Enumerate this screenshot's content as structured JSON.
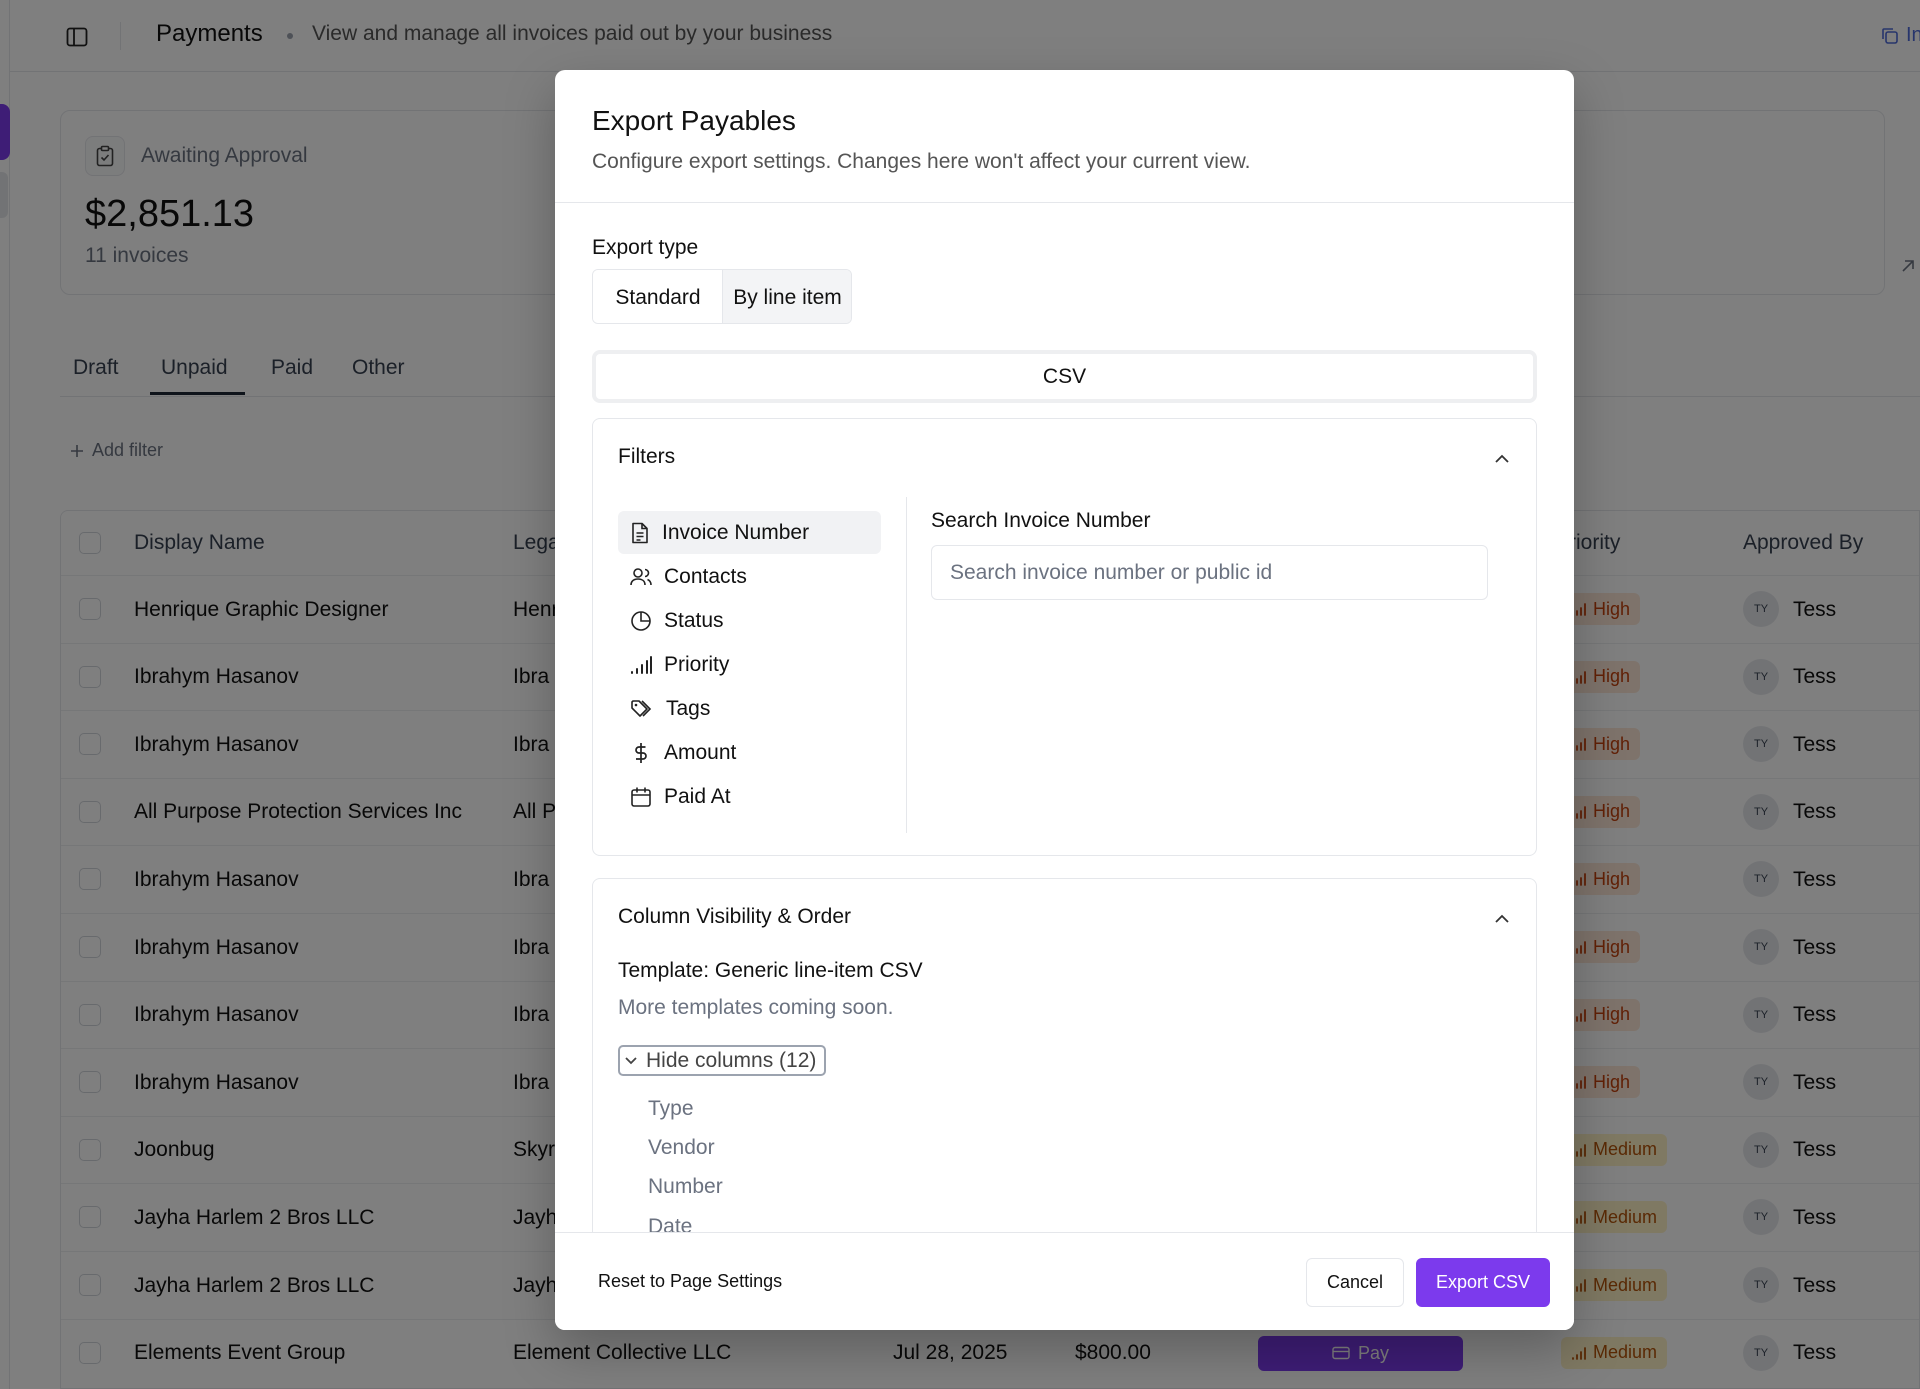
{
  "header": {
    "title": "Payments",
    "subtitle": "View and manage all invoices paid out by your business",
    "right_link": "In"
  },
  "stat_card": {
    "label": "Awaiting Approval",
    "amount": "$2,851.13",
    "count": "11 invoices"
  },
  "tabs": [
    {
      "label": "Draft"
    },
    {
      "label": "Unpaid",
      "active": true
    },
    {
      "label": "Paid"
    },
    {
      "label": "Other"
    }
  ],
  "add_filter": "Add filter",
  "table": {
    "columns": [
      "Display Name",
      "Lega",
      "riority",
      "Approved By"
    ],
    "rows": [
      {
        "display_name": "Henrique Graphic Designer",
        "legal": "Henr",
        "priority": "High",
        "avatar": "TY",
        "approver": "Tess"
      },
      {
        "display_name": "Ibrahym Hasanov",
        "legal": "Ibra",
        "priority": "High",
        "avatar": "TY",
        "approver": "Tess"
      },
      {
        "display_name": "Ibrahym Hasanov",
        "legal": "Ibra",
        "priority": "High",
        "avatar": "TY",
        "approver": "Tess"
      },
      {
        "display_name": "All Purpose Protection Services Inc",
        "legal": "All P",
        "priority": "High",
        "avatar": "TY",
        "approver": "Tess"
      },
      {
        "display_name": "Ibrahym Hasanov",
        "legal": "Ibra",
        "priority": "High",
        "avatar": "TY",
        "approver": "Tess"
      },
      {
        "display_name": "Ibrahym Hasanov",
        "legal": "Ibra",
        "priority": "High",
        "avatar": "TY",
        "approver": "Tess"
      },
      {
        "display_name": "Ibrahym Hasanov",
        "legal": "Ibra",
        "priority": "High",
        "avatar": "TY",
        "approver": "Tess"
      },
      {
        "display_name": "Ibrahym Hasanov",
        "legal": "Ibra",
        "priority": "High",
        "avatar": "TY",
        "approver": "Tess"
      },
      {
        "display_name": "Joonbug",
        "legal": "Skyr",
        "priority": "Medium",
        "avatar": "TY",
        "approver": "Tess"
      },
      {
        "display_name": "Jayha Harlem 2 Bros LLC",
        "legal": "Jayh",
        "priority": "Medium",
        "avatar": "TY",
        "approver": "Tess"
      },
      {
        "display_name": "Jayha Harlem 2 Bros LLC",
        "legal": "Jayh",
        "priority": "Medium",
        "avatar": "TY",
        "approver": "Tess"
      },
      {
        "display_name": "Elements Event Group",
        "legal": "Element Collective LLC",
        "date": "Jul 28, 2025",
        "amount": "$800.00",
        "pay_label": "Pay",
        "priority": "Medium",
        "avatar": "TY",
        "approver": "Tess"
      }
    ]
  },
  "modal": {
    "title": "Export Payables",
    "description": "Configure export settings. Changes here won't affect your current view.",
    "export_type_label": "Export type",
    "export_types": [
      "Standard",
      "By line item"
    ],
    "format": "CSV",
    "filters": {
      "title": "Filters",
      "items": [
        "Invoice Number",
        "Contacts",
        "Status",
        "Priority",
        "Tags",
        "Amount",
        "Paid At"
      ],
      "search_label": "Search Invoice Number",
      "search_placeholder": "Search invoice number or public id"
    },
    "columns": {
      "title": "Column Visibility & Order",
      "template_label": "Template:",
      "template_value": "Generic line-item CSV",
      "template_note": "More templates coming soon.",
      "hide_columns": "Hide columns (12)",
      "items": [
        "Type",
        "Vendor",
        "Number",
        "Date"
      ]
    },
    "footer": {
      "reset": "Reset to Page Settings",
      "cancel": "Cancel",
      "export": "Export CSV"
    }
  },
  "colors": {
    "accent": "#7c3aed",
    "high_bg": "#fde7d6",
    "high_text": "#c2410c",
    "medium_bg": "#fef3c7",
    "medium_text": "#b45309"
  }
}
